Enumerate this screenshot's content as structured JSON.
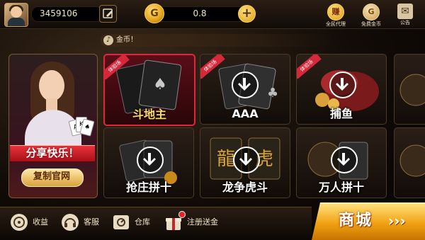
{
  "header": {
    "user_id": "3459106",
    "coin_symbol": "G",
    "coin_balance": "0.8",
    "add_label": "+",
    "top_icons": [
      {
        "name": "full-agent-icon",
        "label": "全民代理",
        "icon_text": "赚"
      },
      {
        "name": "free-coins-icon",
        "label": "免费金币",
        "icon_text": "G"
      },
      {
        "name": "announcement-icon",
        "label": "公告",
        "icon_text": "✉"
      }
    ]
  },
  "marquee": {
    "text": "金币！"
  },
  "promo": {
    "banner": "分享快乐！",
    "copy_button": "复制官网"
  },
  "games": [
    {
      "name": "斗地主",
      "tag": "体验场",
      "downloaded": true
    },
    {
      "name": "AAA",
      "tag": "体验场",
      "downloaded": false
    },
    {
      "name": "捕鱼",
      "tag": "体验场",
      "downloaded": false
    },
    {
      "name": "抢庄拼十",
      "tag": "",
      "downloaded": false
    },
    {
      "name": "龙争虎斗",
      "tag": "",
      "downloaded": false
    },
    {
      "name": "万人拼十",
      "tag": "",
      "downloaded": false
    }
  ],
  "bottom_nav": [
    {
      "label": "收益"
    },
    {
      "label": "客服"
    },
    {
      "label": "仓库"
    },
    {
      "label": "注册送金"
    }
  ],
  "shop": {
    "label": "商城",
    "arrow": "›››"
  },
  "colors": {
    "accent_gold": "#f0a012",
    "highlight_red": "#e0263a"
  }
}
